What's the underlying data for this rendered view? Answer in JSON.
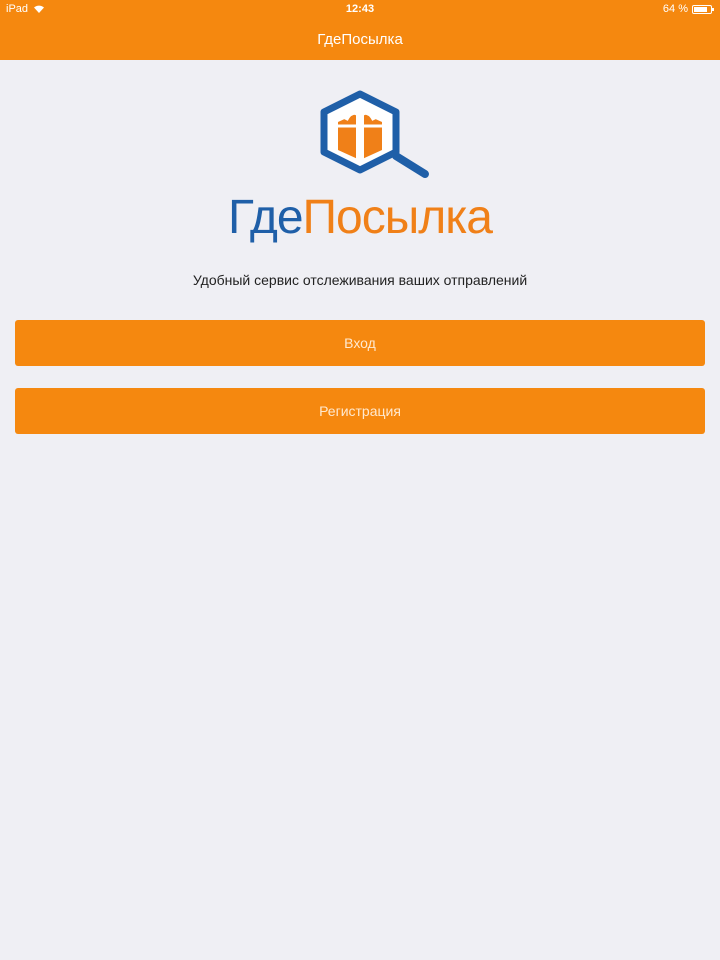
{
  "status_bar": {
    "device": "iPad",
    "time": "12:43",
    "battery_percent": "64 %"
  },
  "nav_bar": {
    "title": "ГдеПосылка"
  },
  "logo": {
    "text_part1": "Где",
    "text_part2": "Посылка",
    "colors": {
      "blue": "#1f5fa8",
      "orange": "#f08018"
    }
  },
  "tagline": "Удобный сервис отслеживания ваших отправлений",
  "buttons": {
    "login": "Вход",
    "register": "Регистрация"
  },
  "theme": {
    "accent": "#f5880f",
    "background": "#efeff4"
  },
  "icons": [
    "wifi-icon",
    "battery-icon",
    "parcel-search-logo-icon"
  ]
}
